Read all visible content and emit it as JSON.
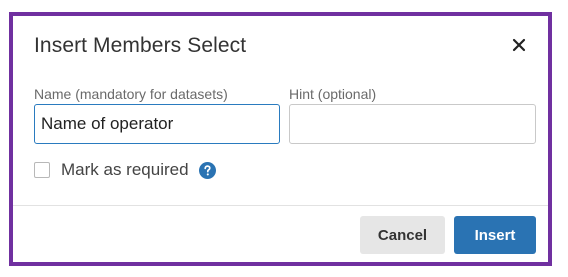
{
  "dialog": {
    "title": "Insert Members Select",
    "close_icon": "close-icon"
  },
  "form": {
    "name_label": "Name (mandatory for datasets)",
    "name_value": "Name of operator",
    "hint_label": "Hint (optional)",
    "hint_value": "",
    "required_label": "Mark as required",
    "required_checked": false,
    "help_icon": "help-icon"
  },
  "footer": {
    "cancel_label": "Cancel",
    "insert_label": "Insert"
  },
  "colors": {
    "frame_border": "#7030a0",
    "primary": "#2a73b3",
    "focus_border": "#2a7bbf",
    "cancel_bg": "#e6e6e6"
  }
}
